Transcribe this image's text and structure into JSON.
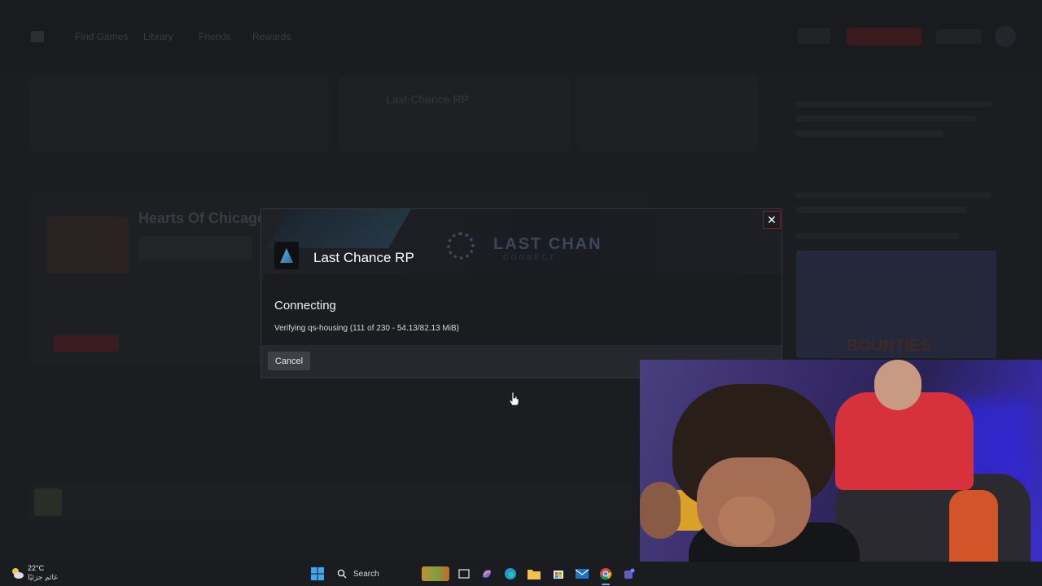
{
  "background_app": {
    "nav": [
      "Find Games",
      "Library",
      "Friends",
      "Rewards"
    ],
    "featured_server_name": "Hearts Of Chicago",
    "panel_server_name": "Last Chance RP",
    "right_banner_text": "BOUNTIES"
  },
  "modal": {
    "server_name": "Last Chance RP",
    "banner_logo": "LAST CHAN",
    "banner_logo_sub": "CONNECT",
    "status": "Connecting",
    "detail": "Verifying qs-housing (111 of 230 - 54.13/82.13 MiB)",
    "cancel_label": "Cancel",
    "close_glyph": "✕"
  },
  "taskbar": {
    "temperature": "22°C",
    "weather_desc": "غائم جزئيًا",
    "search_label": "Search"
  },
  "colors": {
    "accent_close_border": "#7a2030",
    "modal_bg": "#1b1c20",
    "footer_bg": "#27282d"
  }
}
